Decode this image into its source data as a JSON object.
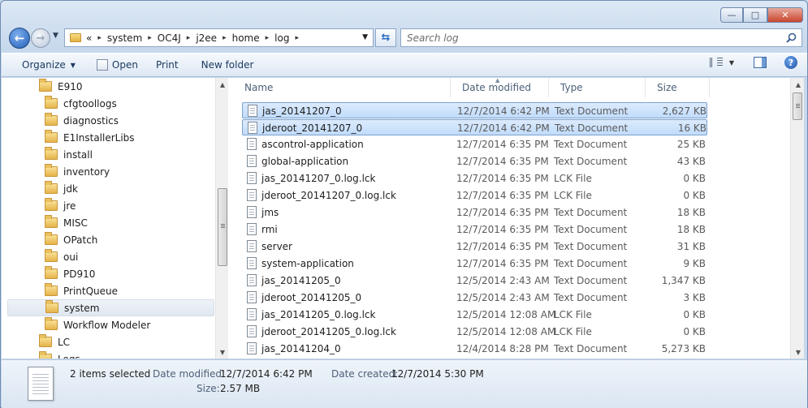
{
  "window": {
    "minimize_glyph": "—",
    "maximize_glyph": "□",
    "close_glyph": "✕"
  },
  "address_bar": {
    "overflow": "«",
    "crumbs": [
      "system",
      "OC4J",
      "j2ee",
      "home",
      "log"
    ]
  },
  "search": {
    "placeholder": "Search log"
  },
  "toolbar": {
    "organize_label": "Organize",
    "open_label": "Open",
    "print_label": "Print",
    "new_folder_label": "New folder"
  },
  "nav_tree": {
    "items": [
      {
        "label": "E910",
        "level": 1
      },
      {
        "label": "cfgtoollogs",
        "level": 2
      },
      {
        "label": "diagnostics",
        "level": 2
      },
      {
        "label": "E1InstallerLibs",
        "level": 2
      },
      {
        "label": "install",
        "level": 2
      },
      {
        "label": "inventory",
        "level": 2
      },
      {
        "label": "jdk",
        "level": 2
      },
      {
        "label": "jre",
        "level": 2
      },
      {
        "label": "MISC",
        "level": 2
      },
      {
        "label": "OPatch",
        "level": 2
      },
      {
        "label": "oui",
        "level": 2
      },
      {
        "label": "PD910",
        "level": 2
      },
      {
        "label": "PrintQueue",
        "level": 2
      },
      {
        "label": "system",
        "level": 2,
        "selected": true
      },
      {
        "label": "Workflow Modeler",
        "level": 2
      },
      {
        "label": "LC",
        "level": 1
      },
      {
        "label": "Logs",
        "level": 1
      }
    ]
  },
  "file_list": {
    "columns": [
      "Name",
      "Date modified",
      "Type",
      "Size"
    ],
    "rows": [
      {
        "name": "jas_20141207_0",
        "modified": "12/7/2014 6:42 PM",
        "type": "Text Document",
        "size": "2,627 KB",
        "selected": true
      },
      {
        "name": "jderoot_20141207_0",
        "modified": "12/7/2014 6:42 PM",
        "type": "Text Document",
        "size": "16 KB",
        "selected": true
      },
      {
        "name": "ascontrol-application",
        "modified": "12/7/2014 6:35 PM",
        "type": "Text Document",
        "size": "25 KB"
      },
      {
        "name": "global-application",
        "modified": "12/7/2014 6:35 PM",
        "type": "Text Document",
        "size": "43 KB"
      },
      {
        "name": "jas_20141207_0.log.lck",
        "modified": "12/7/2014 6:35 PM",
        "type": "LCK File",
        "size": "0 KB"
      },
      {
        "name": "jderoot_20141207_0.log.lck",
        "modified": "12/7/2014 6:35 PM",
        "type": "LCK File",
        "size": "0 KB"
      },
      {
        "name": "jms",
        "modified": "12/7/2014 6:35 PM",
        "type": "Text Document",
        "size": "18 KB"
      },
      {
        "name": "rmi",
        "modified": "12/7/2014 6:35 PM",
        "type": "Text Document",
        "size": "18 KB"
      },
      {
        "name": "server",
        "modified": "12/7/2014 6:35 PM",
        "type": "Text Document",
        "size": "31 KB"
      },
      {
        "name": "system-application",
        "modified": "12/7/2014 6:35 PM",
        "type": "Text Document",
        "size": "9 KB"
      },
      {
        "name": "jas_20141205_0",
        "modified": "12/5/2014 2:43 AM",
        "type": "Text Document",
        "size": "1,347 KB"
      },
      {
        "name": "jderoot_20141205_0",
        "modified": "12/5/2014 2:43 AM",
        "type": "Text Document",
        "size": "3 KB"
      },
      {
        "name": "jas_20141205_0.log.lck",
        "modified": "12/5/2014 12:08 AM",
        "type": "LCK File",
        "size": "0 KB"
      },
      {
        "name": "jderoot_20141205_0.log.lck",
        "modified": "12/5/2014 12:08 AM",
        "type": "LCK File",
        "size": "0 KB"
      },
      {
        "name": "jas_20141204_0",
        "modified": "12/4/2014 8:28 PM",
        "type": "Text Document",
        "size": "5,273 KB"
      }
    ]
  },
  "details": {
    "summary": "2 items selected",
    "date_modified_label": "Date modified:",
    "date_modified_value": "12/7/2014 6:42 PM",
    "date_created_label": "Date created:",
    "date_created_value": "12/7/2014 5:30 PM",
    "size_label": "Size:",
    "size_value": "2.57 MB"
  }
}
